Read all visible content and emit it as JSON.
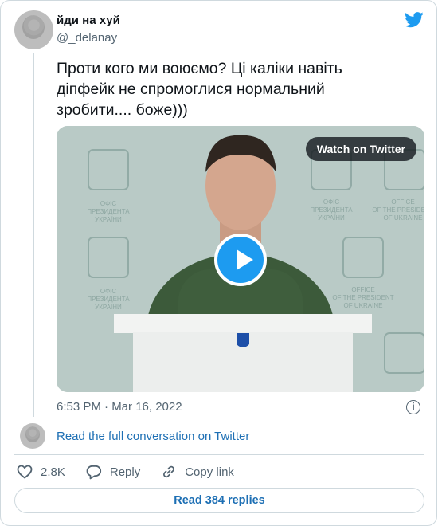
{
  "tweet": {
    "display_name": "йди на хуй",
    "handle": "@_delanay",
    "text": "Проти кого ми воюємо? Ці каліки навіть\nдіпфейк не спромоглися нормальний\nзробити.... боже)))",
    "timestamp": "6:53 PM · Mar 16, 2022"
  },
  "media": {
    "watch_label": "Watch on Twitter",
    "backdrop_text": "ОФІС\nПРЕЗИДЕНТА\nУКРАЇНИ",
    "backdrop_text_en": "OFFICE\nOF THE PRESIDENT\nOF UKRAINE",
    "header_text": "OF UKRAINE"
  },
  "conversation": {
    "link_label": "Read the full conversation on Twitter"
  },
  "actions": {
    "like_count": "2.8K",
    "reply_label": "Reply",
    "copy_label": "Copy link"
  },
  "replies_button": "Read 384 replies",
  "colors": {
    "accent": "#1d9bf0",
    "link": "#1d6fb4",
    "muted": "#536471",
    "border": "#cfd9de"
  },
  "icons": [
    "twitter-bird-icon",
    "play-icon",
    "info-icon",
    "heart-icon",
    "reply-bubble-icon",
    "link-icon"
  ]
}
